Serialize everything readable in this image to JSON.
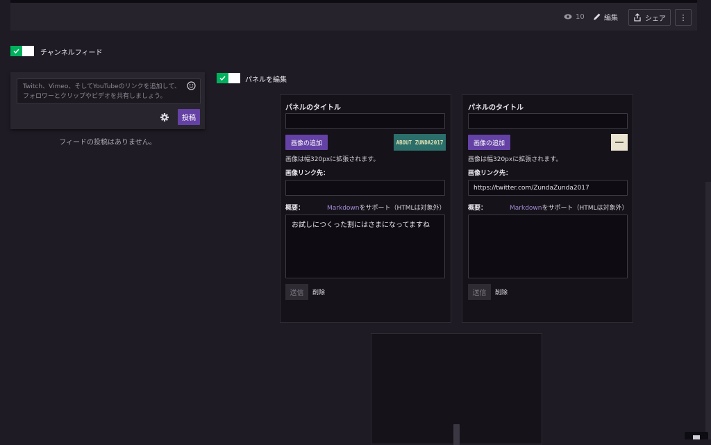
{
  "topbar": {
    "view_count": "10",
    "edit_label": "編集",
    "share_label": "シェア"
  },
  "feed": {
    "toggle_label": "チャンネルフィード",
    "placeholder": "Twitch、Vimeo、そしてYouTubeのリンクを追加して、フォロワーとクリップやビデオを共有しましょう。",
    "post_label": "投稿",
    "empty_text": "フィードの投稿はありません。"
  },
  "panel_edit": {
    "toggle_label": "パネルを編集"
  },
  "panels": [
    {
      "title_label": "パネルのタイトル",
      "title_value": "",
      "add_image_label": "画像の追加",
      "thumb_text": "ABOUT ZUNDA2017",
      "image_note": "画像は幅320pxに拡張されます。",
      "link_label": "画像リンク先：",
      "link_value": "",
      "desc_label": "概要：",
      "markdown_link": "Markdown",
      "markdown_rest": "をサポート（HTMLは対象外）",
      "desc_value": "お試しにつくった割にはさまになってますね",
      "submit_label": "送信",
      "delete_label": "削除"
    },
    {
      "title_label": "パネルのタイトル",
      "title_value": "",
      "add_image_label": "画像の追加",
      "thumb_text": "",
      "image_note": "画像は幅320pxに拡張されます。",
      "link_label": "画像リンク先：",
      "link_value": "https://twitter.com/ZundaZunda2017",
      "desc_label": "概要：",
      "markdown_link": "Markdown",
      "markdown_rest": "をサポート（HTMLは対象外）",
      "desc_value": "",
      "submit_label": "送信",
      "delete_label": "削除"
    }
  ],
  "colors": {
    "background": "#1e1b24",
    "accent_purple": "#6441a4",
    "toggle_green": "#00b05c"
  }
}
